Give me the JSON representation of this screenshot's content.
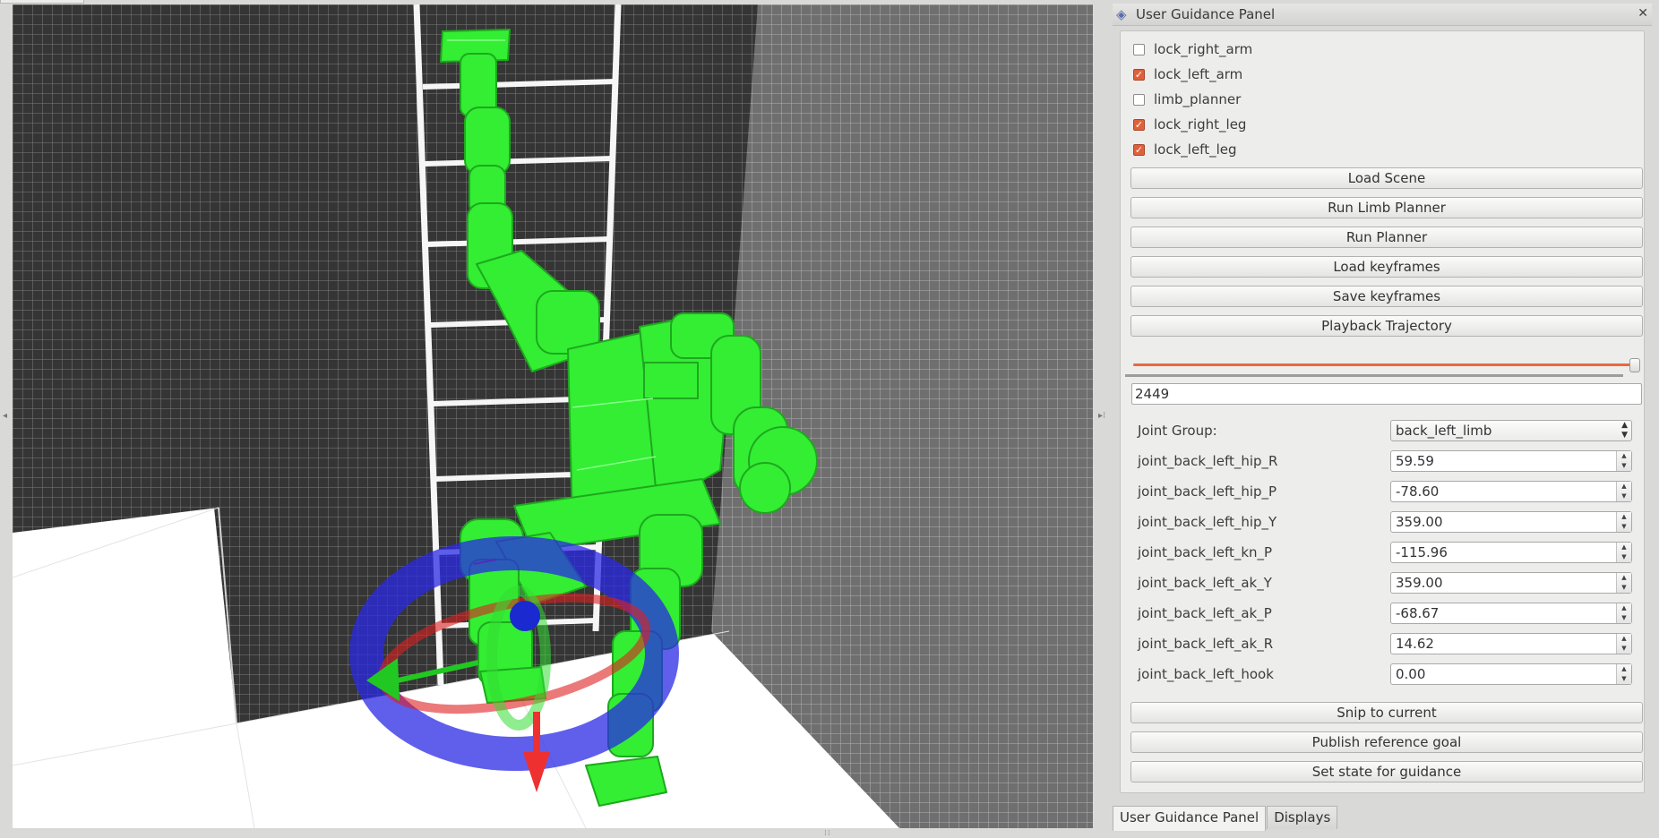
{
  "dock": {
    "title": "User Guidance Panel",
    "close_glyph": "✕",
    "icon": "diamond-panel-icon"
  },
  "checkboxes": [
    {
      "label": "lock_right_arm",
      "checked": false
    },
    {
      "label": "lock_left_arm",
      "checked": true
    },
    {
      "label": "limb_planner",
      "checked": false
    },
    {
      "label": "lock_right_leg",
      "checked": true
    },
    {
      "label": "lock_left_leg",
      "checked": true
    }
  ],
  "buttons": {
    "load_scene": "Load Scene",
    "run_limb_planner": "Run Limb Planner",
    "run_planner": "Run Planner",
    "load_keyframes": "Load keyframes",
    "save_keyframes": "Save keyframes",
    "playback_trajectory": "Playback Trajectory",
    "snip_to_current": "Snip to current",
    "publish_reference_goal": "Publish reference goal",
    "set_state_for_guidance": "Set state for guidance"
  },
  "slider": {
    "fraction": 0.99
  },
  "frame_value": "2449",
  "joint_group": {
    "label": "Joint Group:",
    "value": "back_left_limb"
  },
  "joints": [
    {
      "name": "joint_back_left_hip_R",
      "value": "59.59"
    },
    {
      "name": "joint_back_left_hip_P",
      "value": "-78.60"
    },
    {
      "name": "joint_back_left_hip_Y",
      "value": "359.00"
    },
    {
      "name": "joint_back_left_kn_P",
      "value": "-115.96"
    },
    {
      "name": "joint_back_left_ak_Y",
      "value": "359.00"
    },
    {
      "name": "joint_back_left_ak_P",
      "value": "-68.67"
    },
    {
      "name": "joint_back_left_ak_R",
      "value": "14.62"
    },
    {
      "name": "joint_back_left_hook",
      "value": "0.00"
    }
  ],
  "tabs": [
    {
      "label": "User Guidance Panel",
      "active": true
    },
    {
      "label": "Displays",
      "active": false
    }
  ],
  "colors": {
    "accent": "#e0603a",
    "robot": "#33ee33",
    "wall": "#353535",
    "grid": "#8a8a8a"
  }
}
